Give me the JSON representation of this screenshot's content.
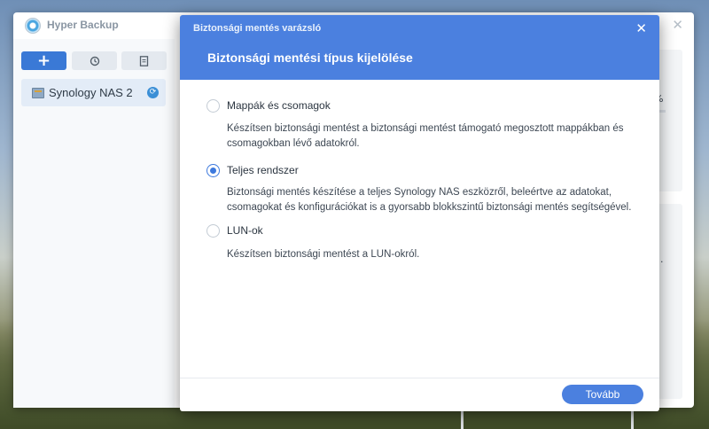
{
  "app": {
    "title": "Hyper Backup",
    "icon": "hyper-backup-logo",
    "close_icon": "✕"
  },
  "toolbar": {
    "add_icon": "+",
    "restore_icon": "history-icon",
    "log_icon": "document-icon"
  },
  "tasks": [
    {
      "label": "Synology NAS 2",
      "icon": "nas-icon",
      "status_icon": "sync-icon"
    }
  ],
  "background_peek": {
    "percent_fragment": "%",
    "ellipsis_fragment": "..."
  },
  "wizard": {
    "window_title": "Biztonsági mentés varázsló",
    "close_icon": "✕",
    "heading": "Biztonsági mentési típus kijelölése",
    "options": [
      {
        "label": "Mappák és csomagok",
        "description": "Készítsen biztonsági mentést a biztonsági mentést támogató megosztott mappákban és csomagokban lévő adatokról.",
        "selected": false
      },
      {
        "label": "Teljes rendszer",
        "description": "Biztonsági mentés készítése a teljes Synology NAS eszközről, beleértve az adatokat, csomagokat és konfigurációkat is a gyorsabb blokkszintű biztonsági mentés segítségével.",
        "selected": true
      },
      {
        "label": "LUN-ok",
        "description": "Készítsen biztonsági mentést a LUN-okról.",
        "selected": false
      }
    ],
    "next_button": "Tovább"
  },
  "colors": {
    "accent": "#4b80df",
    "radio_selected": "#3d79dd"
  }
}
